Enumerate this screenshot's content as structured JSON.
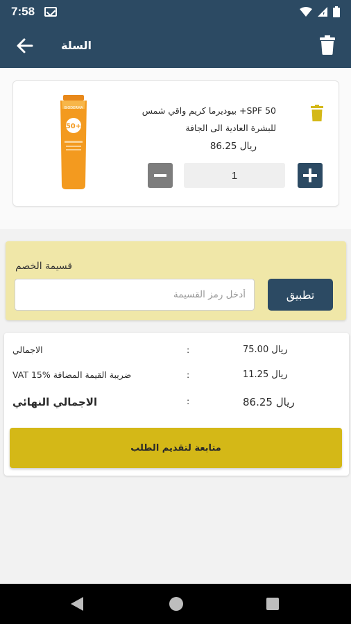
{
  "status_bar": {
    "time": "7:58",
    "icons": [
      "mail-icon",
      "wifi-icon",
      "signal-icon",
      "battery-icon"
    ]
  },
  "app_bar": {
    "title": "السلة",
    "back_icon": "arrow-left-icon",
    "delete_icon": "trash-icon",
    "color": "#2c4a63"
  },
  "cart": {
    "items": [
      {
        "name": "SPF 50+ بيوديرما كريم واقي شمس للبشرة العادية الى الجافة",
        "price": "ريال 86.25",
        "quantity": "1",
        "image_icon": "sunscreen-tube-image"
      }
    ]
  },
  "coupon": {
    "title": "قسيمة الخصم",
    "placeholder": "أدخل رمز القسيمة",
    "value": "",
    "apply_label": "تطبيق",
    "background": "#f0e7a8"
  },
  "totals": {
    "subtotal_label": "الاجمالي",
    "subtotal_value": "ريال    75.00",
    "vat_label": "VAT 15% ضريبة القيمة المضافة",
    "vat_value": "ريال    11.25",
    "final_label": "الاجمالي النهائي",
    "final_value": "ريال    86.25",
    "colon": ":"
  },
  "checkout": {
    "label": "متابعة لتقديم الطلب",
    "color": "#d4b817"
  },
  "nav": {
    "icons": [
      "nav-back-icon",
      "nav-home-icon",
      "nav-recent-icon"
    ]
  }
}
